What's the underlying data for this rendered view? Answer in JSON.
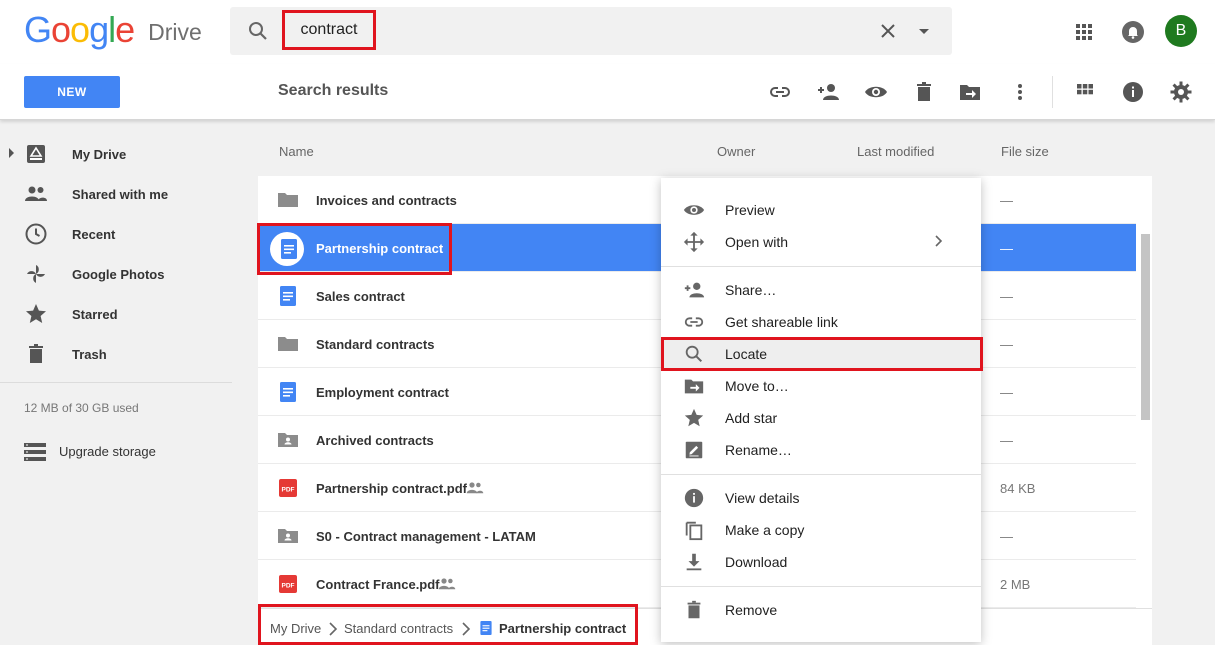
{
  "header": {
    "logo_text": "Google",
    "product": "Drive",
    "search_query": "contract",
    "avatar_letter": "B",
    "colors": {
      "brand_blue": "#4285F4",
      "brand_red": "#EA4335",
      "brand_yellow": "#FBBC05",
      "brand_green": "#34A853",
      "avatar": "#1f7a1f",
      "highlight": "#e0141e"
    }
  },
  "toolbar": {
    "new_label": "NEW",
    "title": "Search results",
    "icons": [
      "link-icon",
      "add-person-icon",
      "eye-icon",
      "trash-icon",
      "move-to-folder-icon",
      "more-vert-icon",
      "grid-view-icon",
      "info-icon",
      "settings-gear-icon"
    ]
  },
  "sidebar": {
    "items": [
      {
        "label": "My Drive",
        "icon": "drive-icon"
      },
      {
        "label": "Shared with me",
        "icon": "people-icon"
      },
      {
        "label": "Recent",
        "icon": "clock-icon"
      },
      {
        "label": "Google Photos",
        "icon": "pinwheel-icon"
      },
      {
        "label": "Starred",
        "icon": "star-icon"
      },
      {
        "label": "Trash",
        "icon": "trash-icon"
      }
    ],
    "storage": "12 MB of 30 GB used",
    "upgrade": "Upgrade storage"
  },
  "columns": {
    "name": "Name",
    "owner": "Owner",
    "modified": "Last modified",
    "size": "File size"
  },
  "files": [
    {
      "name": "Invoices and contracts",
      "type": "folder",
      "size": "—"
    },
    {
      "name": "Partnership contract",
      "type": "doc",
      "size": "—",
      "selected": true
    },
    {
      "name": "Sales contract",
      "type": "doc",
      "size": "—"
    },
    {
      "name": "Standard contracts",
      "type": "folder",
      "size": "—"
    },
    {
      "name": "Employment contract",
      "type": "doc",
      "size": "—"
    },
    {
      "name": "Archived contracts",
      "type": "shared-folder",
      "size": "—"
    },
    {
      "name": "Partnership contract.pdf",
      "type": "pdf",
      "size": "84 KB",
      "shared": true
    },
    {
      "name": "S0 - Contract management - LATAM",
      "type": "shared-folder",
      "size": "—"
    },
    {
      "name": "Contract France.pdf",
      "type": "pdf",
      "size": "2 MB",
      "shared": true
    }
  ],
  "pdf_badge": "PDF",
  "breadcrumb": [
    "My Drive",
    "Standard contracts",
    "Partnership contract"
  ],
  "context_menu": {
    "items": [
      {
        "label": "Preview",
        "icon": "eye-icon"
      },
      {
        "label": "Open with",
        "icon": "open-with-icon"
      },
      {
        "label": "Share…",
        "icon": "add-person-icon"
      },
      {
        "label": "Get shareable link",
        "icon": "link-icon"
      },
      {
        "label": "Locate",
        "icon": "search-icon"
      },
      {
        "label": "Move to…",
        "icon": "move-to-folder-icon"
      },
      {
        "label": "Add star",
        "icon": "star-icon"
      },
      {
        "label": "Rename…",
        "icon": "pencil-icon"
      },
      {
        "label": "View details",
        "icon": "info-icon"
      },
      {
        "label": "Make a copy",
        "icon": "copy-icon"
      },
      {
        "label": "Download",
        "icon": "download-icon"
      },
      {
        "label": "Remove",
        "icon": "trash-icon"
      }
    ]
  }
}
